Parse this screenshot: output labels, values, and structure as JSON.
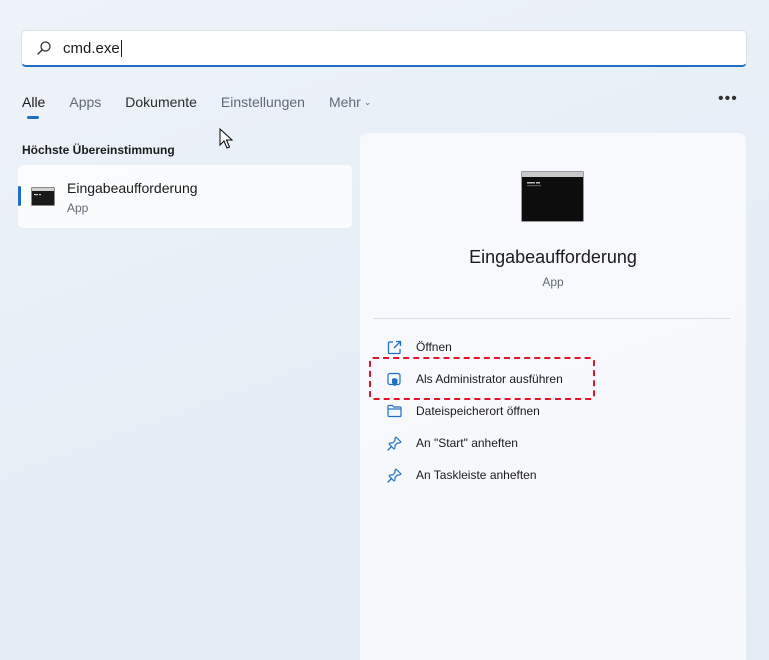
{
  "search": {
    "value": "cmd.exe"
  },
  "tabs": [
    {
      "label": "Alle"
    },
    {
      "label": "Apps"
    },
    {
      "label": "Dokumente"
    },
    {
      "label": "Einstellungen"
    },
    {
      "label": "Mehr"
    }
  ],
  "results": {
    "section_title": "Höchste Übereinstimmung",
    "items": [
      {
        "name": "Eingabeaufforderung",
        "type": "App"
      }
    ]
  },
  "detail": {
    "title": "Eingabeaufforderung",
    "type": "App",
    "actions": [
      {
        "label": "Öffnen",
        "icon": "open-icon"
      },
      {
        "label": "Als Administrator ausführen",
        "icon": "shield-icon"
      },
      {
        "label": "Dateispeicherort öffnen",
        "icon": "folder-icon"
      },
      {
        "label": "An \"Start\" anheften",
        "icon": "pin-icon"
      },
      {
        "label": "An Taskleiste anheften",
        "icon": "pin-icon"
      }
    ]
  },
  "colors": {
    "accent": "#1f6fc5",
    "highlight": "#e0152c"
  }
}
